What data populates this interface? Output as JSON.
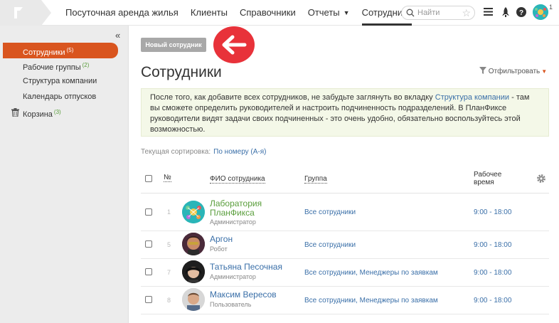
{
  "topbar": {
    "nav": [
      {
        "label": "Посуточная аренда жилья",
        "active": false,
        "caret": false
      },
      {
        "label": "Клиенты",
        "active": false,
        "caret": false
      },
      {
        "label": "Справочники",
        "active": false,
        "caret": false
      },
      {
        "label": "Отчеты",
        "active": false,
        "caret": true
      },
      {
        "label": "Сотрудники",
        "active": true,
        "caret": false
      }
    ],
    "search_placeholder": "Найти",
    "avatar_badge": "1"
  },
  "sidebar": {
    "collapse_glyph": "«",
    "items": [
      {
        "label": "Сотрудники",
        "count": "(5)",
        "active": true
      },
      {
        "label": "Рабочие группы",
        "count": "(2)",
        "active": false
      },
      {
        "label": "Структура компании",
        "count": "",
        "active": false
      },
      {
        "label": "Календарь отпусков",
        "count": "",
        "active": false
      },
      {
        "label": "Корзина",
        "count": "(3)",
        "active": false
      }
    ]
  },
  "main": {
    "new_button": "Новый сотрудник",
    "title": "Сотрудники",
    "filter_label": "Отфильтровать",
    "notice": {
      "line1_a": "После того, как добавите всех сотрудников, не забудьте заглянуть во вкладку ",
      "line1_link": "Структура компании",
      "line1_b": " - там",
      "line2": "вы сможете определить руководителей и настроить подчиненность подразделений. В ПланФиксе",
      "line3": "руководители видят задачи своих подчиненных - это очень удобно, обязательно воспользуйтесь этой",
      "line4": "возможностью."
    },
    "sort_label": "Текущая сортировка:",
    "sort_value": "По номеру (А-я)",
    "table": {
      "headers": {
        "num": "№",
        "name": "ФИО сотрудника",
        "group": "Группа",
        "time_l1": "Рабочее",
        "time_l2": "время"
      },
      "rows": [
        {
          "num": "1",
          "name_l1": "Лаборатория",
          "name_l2": "ПланФикса",
          "role": "Администратор",
          "group": "Все сотрудники",
          "time": "9:00 - 18:00"
        },
        {
          "num": "5",
          "name_l1": "Аргон",
          "name_l2": "",
          "role": "Робот",
          "group": "Все сотрудники",
          "time": "9:00 - 18:00"
        },
        {
          "num": "7",
          "name_l1": "Татьяна Песочная",
          "name_l2": "",
          "role": "Администратор",
          "group": "Все сотрудники, Менеджеры по заявкам",
          "time": "9:00 - 18:00"
        },
        {
          "num": "8",
          "name_l1": "Максим Вересов",
          "name_l2": "",
          "role": "Пользователь",
          "group": "Все сотрудники, Менеджеры по заявкам",
          "time": "9:00 - 18:00"
        }
      ]
    }
  },
  "colors": {
    "accent": "#d9551f",
    "link": "#3a6fa8",
    "green": "#5a9e3c",
    "callout": "#e8323a"
  }
}
